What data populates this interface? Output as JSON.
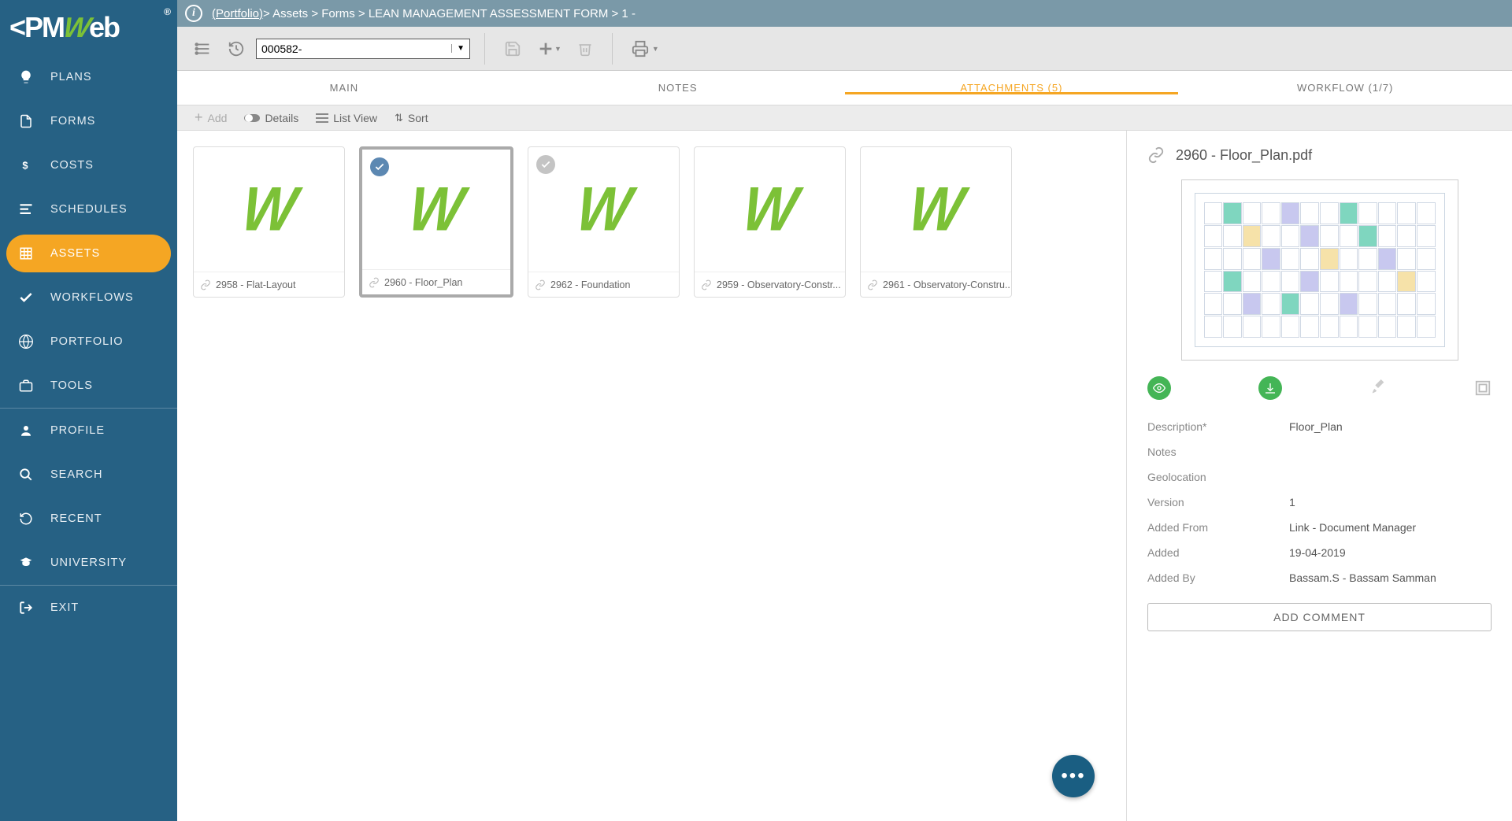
{
  "logo": "PMWeb",
  "breadcrumb": {
    "portfolio": "(Portfolio)",
    "parts": [
      " > Assets > Forms > LEAN MANAGEMENT ASSESSMENT FORM > 1 - "
    ]
  },
  "recordSelector": "000582-",
  "sidebar": [
    {
      "icon": "bulb",
      "label": "PLANS"
    },
    {
      "icon": "doc",
      "label": "FORMS"
    },
    {
      "icon": "dollar",
      "label": "COSTS"
    },
    {
      "icon": "bars",
      "label": "SCHEDULES"
    },
    {
      "icon": "grid",
      "label": "ASSETS",
      "active": true
    },
    {
      "icon": "check",
      "label": "WORKFLOWS"
    },
    {
      "icon": "globe",
      "label": "PORTFOLIO"
    },
    {
      "icon": "briefcase",
      "label": "TOOLS"
    },
    {
      "divider": true
    },
    {
      "icon": "user",
      "label": "PROFILE"
    },
    {
      "icon": "search",
      "label": "SEARCH"
    },
    {
      "icon": "history",
      "label": "RECENT"
    },
    {
      "icon": "grad",
      "label": "UNIVERSITY"
    },
    {
      "divider": true
    },
    {
      "icon": "exit",
      "label": "EXIT"
    }
  ],
  "tabs": [
    {
      "label": "MAIN"
    },
    {
      "label": "NOTES"
    },
    {
      "label": "ATTACHMENTS (5)",
      "active": true
    },
    {
      "label": "WORKFLOW (1/7)"
    }
  ],
  "attbar": {
    "add": "Add",
    "details": "Details",
    "list": "List View",
    "sort": "Sort"
  },
  "cards": [
    {
      "id": "2958",
      "label": "2958 - Flat-Layout",
      "selected": false,
      "badge": ""
    },
    {
      "id": "2960",
      "label": "2960 - Floor_Plan",
      "selected": true,
      "badge": "blue"
    },
    {
      "id": "2962",
      "label": "2962 - Foundation",
      "selected": false,
      "badge": "grey"
    },
    {
      "id": "2959",
      "label": "2959 - Observatory-Constr...",
      "selected": false,
      "badge": ""
    },
    {
      "id": "2961",
      "label": "2961 - Observatory-Constru...",
      "selected": false,
      "badge": ""
    }
  ],
  "detail": {
    "title": "2960 - Floor_Plan.pdf",
    "meta": [
      {
        "lbl": "Description*",
        "val": "Floor_Plan"
      },
      {
        "lbl": "Notes",
        "val": ""
      },
      {
        "lbl": "Geolocation",
        "val": ""
      },
      {
        "lbl": "Version",
        "val": "1"
      },
      {
        "lbl": "Added From",
        "val": "Link - Document Manager"
      },
      {
        "lbl": "Added",
        "val": "19-04-2019"
      },
      {
        "lbl": "Added By",
        "val": "Bassam.S - Bassam Samman"
      }
    ],
    "addComment": "ADD COMMENT"
  }
}
